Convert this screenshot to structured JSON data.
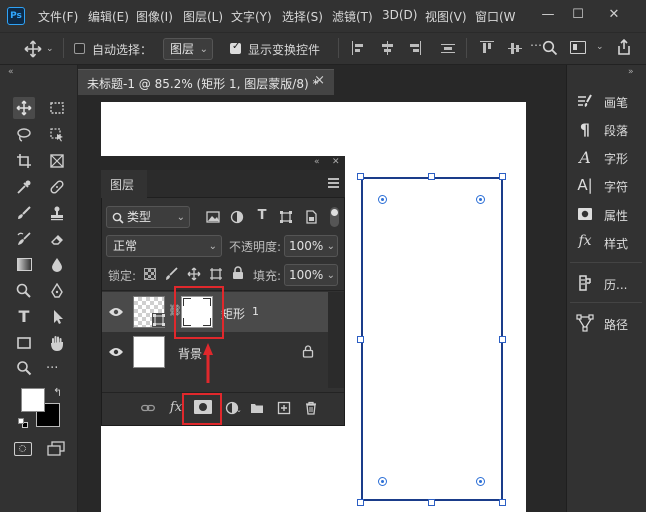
{
  "app": {
    "logo": "Ps"
  },
  "menu": [
    "文件(F)",
    "编辑(E)",
    "图像(I)",
    "图层(L)",
    "文字(Y)",
    "选择(S)",
    "滤镜(T)",
    "3D(D)",
    "视图(V)",
    "窗口(W"
  ],
  "options": {
    "auto_select_label": "自动选择：",
    "auto_select_checked": false,
    "auto_select_target": "图层",
    "show_transform_label": "显示变换控件",
    "show_transform_checked": true
  },
  "document": {
    "tab_title": "未标题-1 @ 85.2% (矩形 1, 图层蒙版/8) *",
    "close": "×"
  },
  "right_panel": {
    "items": [
      {
        "icon": "brush-icon",
        "label": "画笔"
      },
      {
        "icon": "paragraph-icon",
        "label": "段落"
      },
      {
        "icon": "character-icon",
        "label": "字形"
      },
      {
        "icon": "glyphs-icon",
        "label": "字符"
      },
      {
        "icon": "properties-icon",
        "label": "属性"
      },
      {
        "icon": "styles-icon",
        "label": "样式"
      },
      {
        "icon": "history-icon",
        "label": "历..."
      },
      {
        "icon": "paths-icon",
        "label": "路径"
      }
    ]
  },
  "layers_panel": {
    "tab": "图层",
    "filter": "类型",
    "blend_mode": "正常",
    "opacity_label": "不透明度:",
    "opacity": "100%",
    "lock_label": "锁定:",
    "fill_label": "填充:",
    "fill": "100%",
    "layers": [
      {
        "name": "矩形",
        "number": "1",
        "selected": true,
        "has_mask": true
      },
      {
        "name": "背景",
        "selected": false,
        "locked": true
      }
    ]
  },
  "colors": {
    "accent_blue": "#2c6fd6",
    "highlight_red": "#e0282c",
    "panel_bg": "#323232"
  }
}
